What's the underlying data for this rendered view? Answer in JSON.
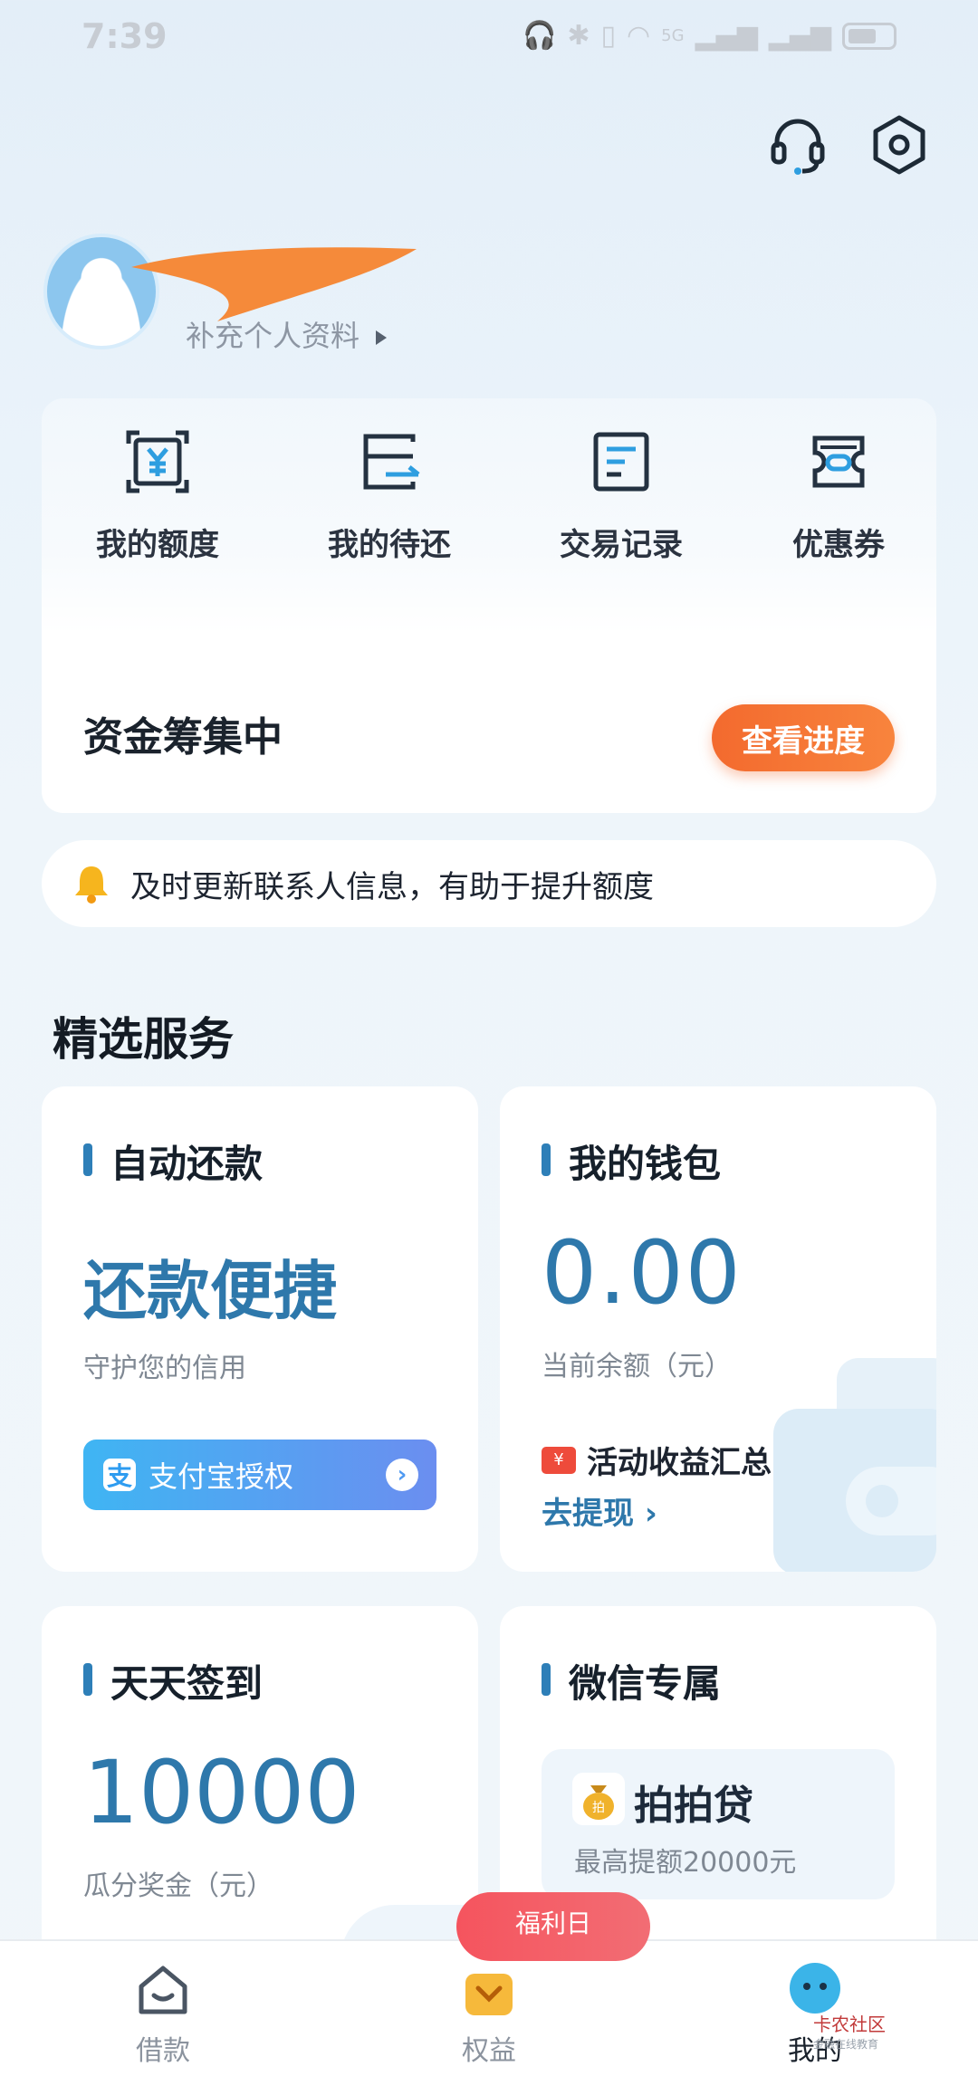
{
  "status_bar": {
    "time": "7:39",
    "network_label": "5G"
  },
  "profile": {
    "complete_info_label": "补充个人资料"
  },
  "quick_actions": [
    {
      "label": "我的额度",
      "icon": "yuan-frame-icon"
    },
    {
      "label": "我的待还",
      "icon": "card-arrow-icon"
    },
    {
      "label": "交易记录",
      "icon": "receipt-icon"
    },
    {
      "label": "优惠券",
      "icon": "coupon-icon"
    }
  ],
  "funding": {
    "status": "资金筹集中",
    "action_label": "查看进度"
  },
  "notice": {
    "text": "及时更新联系人信息，有助于提升额度"
  },
  "section": {
    "title": "精选服务"
  },
  "cards": {
    "auto_repay": {
      "title": "自动还款",
      "headline": "还款便捷",
      "subtitle": "守护您的信用",
      "button_label": "支付宝授权",
      "button_icon_text": "支"
    },
    "wallet": {
      "title": "我的钱包",
      "balance": "0.00",
      "balance_label": "当前余额（元）",
      "activity_label": "活动收益汇总",
      "withdraw_label": "去提现 ›"
    },
    "checkin": {
      "title": "天天签到",
      "amount": "10000",
      "amount_label": "瓜分奖金（元）"
    },
    "wechat": {
      "title": "微信专属",
      "brand": "拍拍贷",
      "brand_sub": "最高提额20000元"
    }
  },
  "bottom_nav": {
    "items": [
      {
        "label": "借款",
        "icon": "house-icon"
      },
      {
        "label": "权益",
        "icon": "gift-icon"
      },
      {
        "label": "我的",
        "icon": "profile-face-icon"
      }
    ],
    "welfare_badge": "福利日"
  },
  "watermark": {
    "title": "卡农社区",
    "sub": "金融在线教育"
  },
  "colors": {
    "accent_blue": "#2e78ab",
    "orange": "#f36a2e",
    "red_pill": "#f5545e"
  }
}
